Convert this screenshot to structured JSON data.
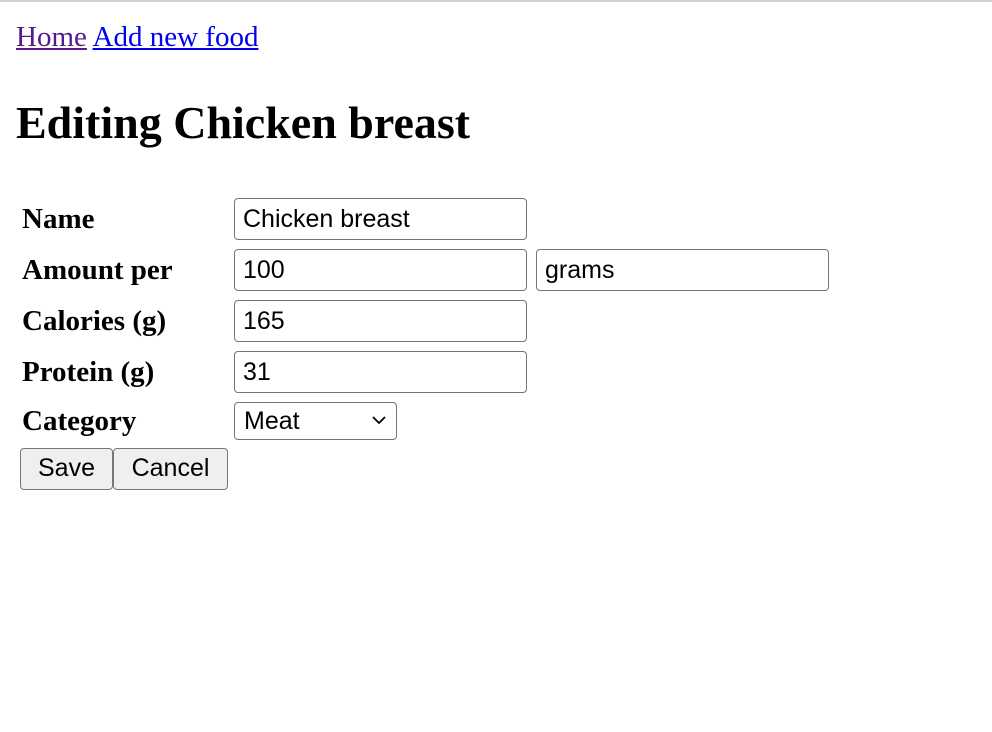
{
  "nav": {
    "home_label": "Home",
    "add_food_label": "Add new food"
  },
  "page": {
    "title": "Editing Chicken breast"
  },
  "form": {
    "name": {
      "label": "Name",
      "value": "Chicken breast"
    },
    "amount": {
      "label": "Amount per",
      "value": "100",
      "unit": "grams"
    },
    "calories": {
      "label": "Calories (g)",
      "value": "165"
    },
    "protein": {
      "label": "Protein (g)",
      "value": "31"
    },
    "category": {
      "label": "Category",
      "selected": "Meat",
      "icon": "chevron-down-icon"
    },
    "save_label": "Save",
    "cancel_label": "Cancel"
  },
  "colors": {
    "visited_link": "#551a8b",
    "link": "#0000ee",
    "button_bg": "#efefef",
    "input_border": "#767676"
  }
}
